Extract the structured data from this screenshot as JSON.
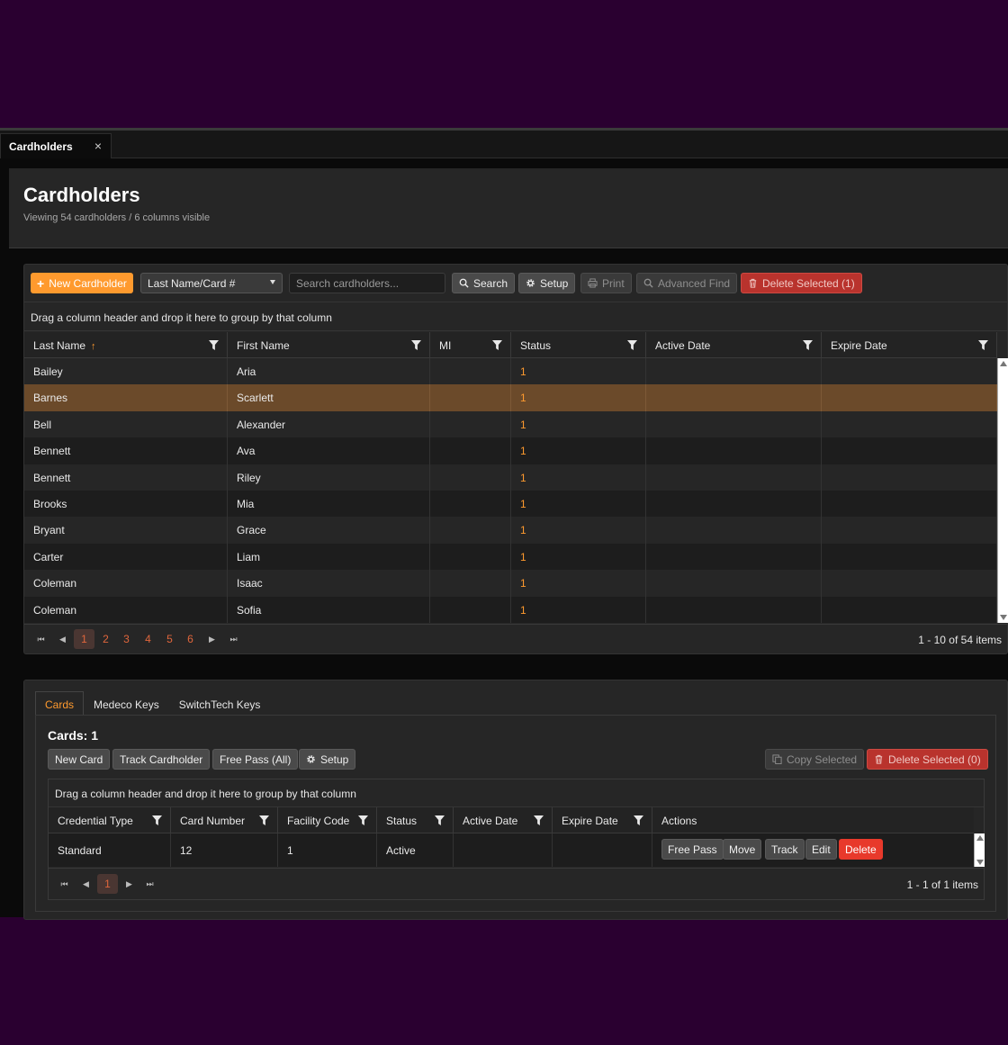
{
  "tab": {
    "label": "Cardholders",
    "close": "×"
  },
  "header": {
    "title": "Cardholders",
    "subtitle": "Viewing 54 cardholders / 6 columns visible"
  },
  "toolbar": {
    "new_label": "New Cardholder",
    "new_prefix": "+",
    "select_value": "Last Name/Card #",
    "search_placeholder": "Search cardholders...",
    "search_label": "Search",
    "setup_label": "Setup",
    "print_label": "Print",
    "advanced_label": "Advanced Find",
    "delete_label": "Delete Selected (1)"
  },
  "groupbar": "Drag a column header and drop it here to group by that column",
  "columns": [
    "Last Name",
    "First Name",
    "MI",
    "Status",
    "Active Date",
    "Expire Date"
  ],
  "sort_indicator": "↑",
  "rows": [
    {
      "last": "Bailey",
      "first": "Aria",
      "mi": "",
      "status": "1",
      "active": "",
      "expire": ""
    },
    {
      "last": "Barnes",
      "first": "Scarlett",
      "mi": "",
      "status": "1",
      "active": "",
      "expire": ""
    },
    {
      "last": "Bell",
      "first": "Alexander",
      "mi": "",
      "status": "1",
      "active": "",
      "expire": ""
    },
    {
      "last": "Bennett",
      "first": "Ava",
      "mi": "",
      "status": "1",
      "active": "",
      "expire": ""
    },
    {
      "last": "Bennett",
      "first": "Riley",
      "mi": "",
      "status": "1",
      "active": "",
      "expire": ""
    },
    {
      "last": "Brooks",
      "first": "Mia",
      "mi": "",
      "status": "1",
      "active": "",
      "expire": ""
    },
    {
      "last": "Bryant",
      "first": "Grace",
      "mi": "",
      "status": "1",
      "active": "",
      "expire": ""
    },
    {
      "last": "Carter",
      "first": "Liam",
      "mi": "",
      "status": "1",
      "active": "",
      "expire": ""
    },
    {
      "last": "Coleman",
      "first": "Isaac",
      "mi": "",
      "status": "1",
      "active": "",
      "expire": ""
    },
    {
      "last": "Coleman",
      "first": "Sofia",
      "mi": "",
      "status": "1",
      "active": "",
      "expire": ""
    }
  ],
  "selected_row_index": 1,
  "pager": {
    "pages": [
      "1",
      "2",
      "3",
      "4",
      "5",
      "6"
    ],
    "current": "1",
    "info": "1 - 10 of 54 items"
  },
  "details": {
    "tabs": [
      "Cards",
      "Medeco Keys",
      "SwitchTech Keys"
    ],
    "active_tab": "Cards",
    "title": "Cards: 1",
    "buttons": {
      "new_card": "New Card",
      "track": "Track Cardholder",
      "free_pass_all": "Free Pass (All)",
      "setup": "Setup",
      "copy": "Copy Selected",
      "delete": "Delete Selected (0)"
    },
    "groupbar": "Drag a column header and drop it here to group by that column",
    "columns": [
      "Credential Type",
      "Card Number",
      "Facility Code",
      "Status",
      "Active Date",
      "Expire Date",
      "Actions"
    ],
    "row": {
      "type": "Standard",
      "number": "12",
      "facility": "1",
      "status": "Active",
      "active": "",
      "expire": ""
    },
    "row_actions": [
      "Free Pass",
      "Move",
      "Track",
      "Edit",
      "Delete"
    ],
    "pager": {
      "current": "1",
      "info": "1 - 1 of 1 items"
    }
  },
  "colors": {
    "accent": "#ff9a2e",
    "danger": "#e8392b",
    "background": "#2a0030",
    "selected_row": "#6b4a2a"
  }
}
